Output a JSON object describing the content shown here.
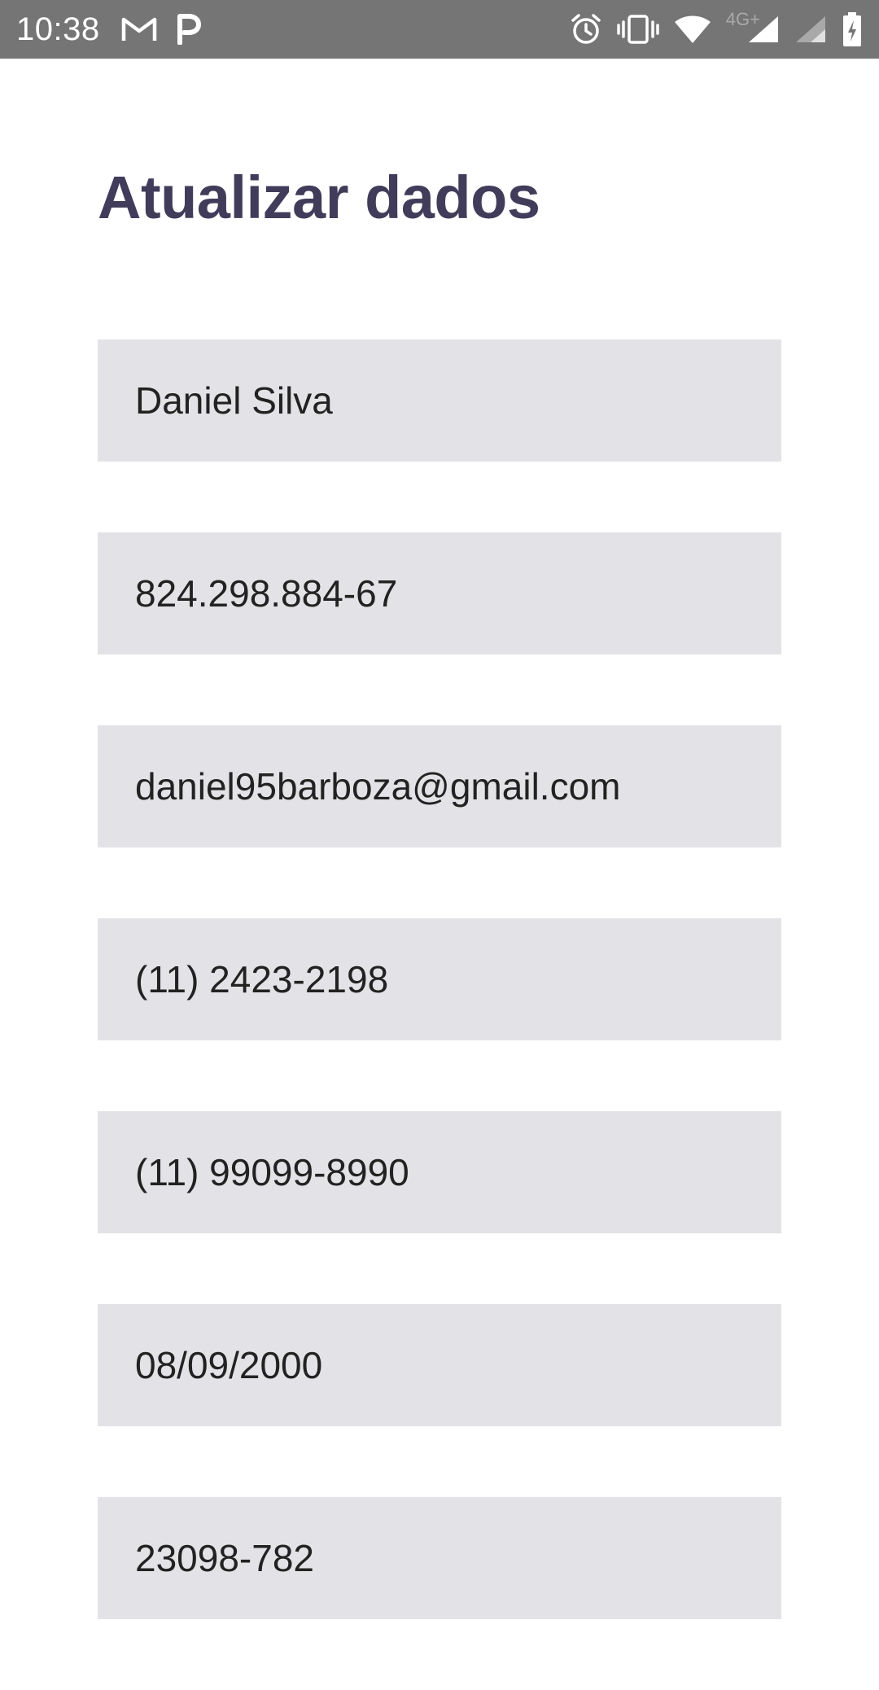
{
  "status_bar": {
    "time": "10:38",
    "network_label": "4G+"
  },
  "page": {
    "title": "Atualizar dados"
  },
  "fields": [
    {
      "value": "Daniel Silva"
    },
    {
      "value": "824.298.884-67"
    },
    {
      "value": "daniel95barboza@gmail.com"
    },
    {
      "value": "(11) 2423-2198"
    },
    {
      "value": "(11) 99099-8990"
    },
    {
      "value": "08/09/2000"
    },
    {
      "value": "23098-782"
    }
  ],
  "colors": {
    "status_bar": "#757575",
    "title": "#403c5a",
    "field_background": "#e3e3e7",
    "field_text": "#222222"
  }
}
